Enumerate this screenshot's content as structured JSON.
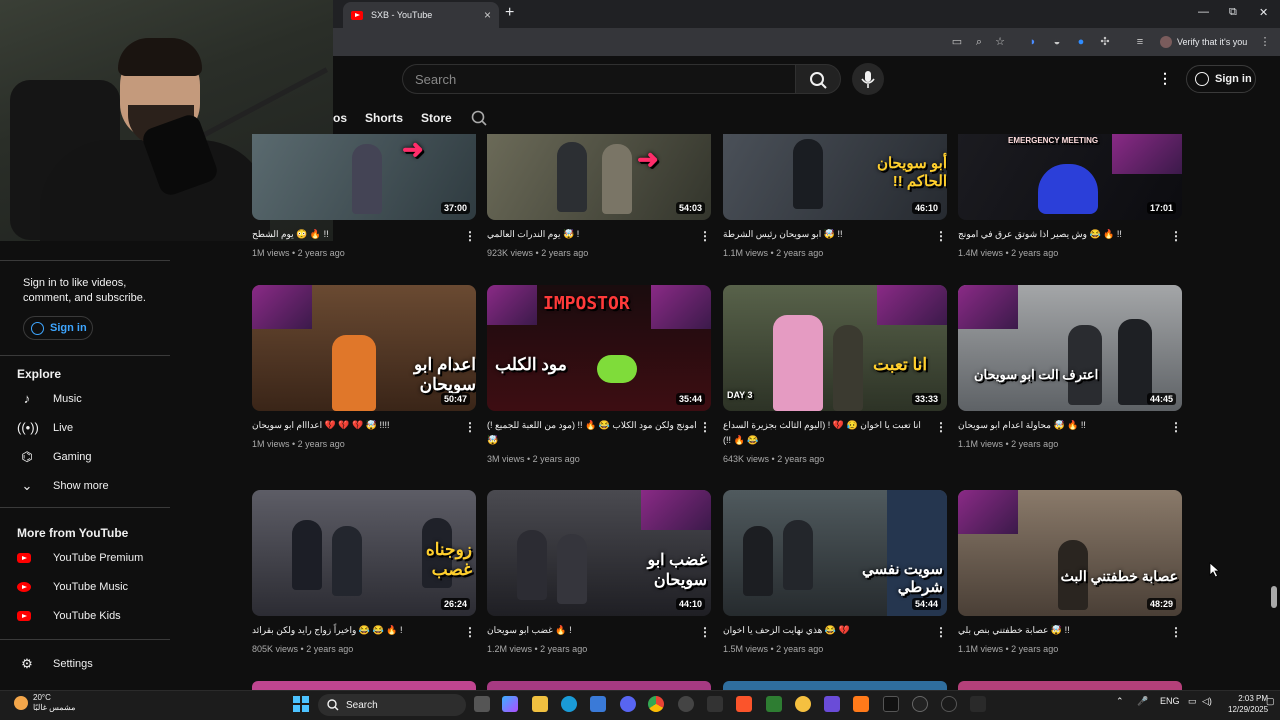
{
  "browser": {
    "tab_title": "SXB - YouTube",
    "new_tab": "+",
    "close_tab": "×",
    "window_controls": [
      "—",
      "⧉",
      "✕"
    ],
    "profile_chip": "Verify that it's you"
  },
  "header": {
    "search_placeholder": "Search",
    "sign_in": "Sign in",
    "chips": [
      "os",
      "Shorts",
      "Store"
    ]
  },
  "sidebar": {
    "sign_in_prompt_line1": "Sign in to like videos,",
    "sign_in_prompt_line2": "comment, and subscribe.",
    "sign_in_button": "Sign in",
    "explore_heading": "Explore",
    "explore_items": [
      {
        "label": "Music",
        "icon": "music-note-icon"
      },
      {
        "label": "Live",
        "icon": "live-icon"
      },
      {
        "label": "Gaming",
        "icon": "gaming-icon"
      },
      {
        "label": "Show more",
        "icon": "chevron-down-icon"
      }
    ],
    "more_heading": "More from YouTube",
    "more_items": [
      {
        "label": "YouTube Premium",
        "icon": "youtube-premium-icon"
      },
      {
        "label": "YouTube Music",
        "icon": "youtube-music-icon"
      },
      {
        "label": "YouTube Kids",
        "icon": "youtube-kids-icon"
      }
    ],
    "settings": "Settings"
  },
  "videos": [
    {
      "title": "!! 🔥 😳 يوم الشطح",
      "views": "1M views",
      "age": "2 years ago",
      "duration": "37:00",
      "overlay": ""
    },
    {
      "title": "! 🤯 يوم الندرات العالمي",
      "views": "923K views",
      "age": "2 years ago",
      "duration": "54:03",
      "overlay": ""
    },
    {
      "title": "!! 🤯 ابو سويحان رئيس الشرطة",
      "views": "1.1M views",
      "age": "2 years ago",
      "duration": "46:10",
      "overlay": "أبو سويحان الحاكم !!"
    },
    {
      "title": "!! 🔥 😂 وش يصير اذا شوتق عرق في امونج",
      "views": "1.4M views",
      "age": "2 years ago",
      "duration": "17:01",
      "overlay": ""
    },
    {
      "title": "!!!! 🤯 💔 💔 💔 اعدااام ابو سويحان",
      "views": "1M views",
      "age": "2 years ago",
      "duration": "50:47",
      "overlay": "اعدام ابو سويحان"
    },
    {
      "title": "امونج ولكن مود الكلاب 😂 🔥 !! (مود من اللعبة للجميع !) 🤯",
      "views": "3M views",
      "age": "2 years ago",
      "duration": "35:44",
      "overlay": "مود الكلب"
    },
    {
      "title": "انا تعبت يا اخوان 😥 💔 ! (اليوم الثالث بجزيرة السداع 😂 🔥 !!)",
      "views": "643K views",
      "age": "2 years ago",
      "duration": "33:33",
      "overlay": "انا تعبت"
    },
    {
      "title": "!! 🔥 🤯 محاولة اعدام ابو سويحان",
      "views": "1.1M views",
      "age": "2 years ago",
      "duration": "44:45",
      "overlay": "اعترف الت ابو سويحان"
    },
    {
      "title": "! 🔥 😂 😂 واخيراً زواج رايد ولكن بقرائد",
      "views": "805K views",
      "age": "2 years ago",
      "duration": "26:24",
      "overlay": "زوجناه غصب"
    },
    {
      "title": "! 🔥 غضب ابو سويحان",
      "views": "1.2M views",
      "age": "2 years ago",
      "duration": "44:10",
      "overlay": "غضب ابو سويحان"
    },
    {
      "title": "💔 😂 هذي نهايت الزحف يا اخوان",
      "views": "1.5M views",
      "age": "2 years ago",
      "duration": "54:44",
      "overlay": "سويت نفسي شرطي"
    },
    {
      "title": "!! 🤯 عصابة خطفتني بنص بلي",
      "views": "1.1M views",
      "age": "2 years ago",
      "duration": "48:29",
      "overlay": "عصابة خطفتني البث"
    }
  ],
  "thumb_overlays_extra": {
    "impostor": "IMPOSTOR",
    "emergency": "EMERGENCY MEETING",
    "day": "DAY 3"
  },
  "taskbar": {
    "weather_temp": "20°C",
    "weather_desc": "مشمس غالبًا",
    "search": "Search",
    "lang": "ENG",
    "time": "2:03 PM",
    "date": "12/29/2025"
  },
  "colors": {
    "accent_blue": "#3ea6ff",
    "yt_red": "#ff0000",
    "bg": "#0f0f0f"
  }
}
